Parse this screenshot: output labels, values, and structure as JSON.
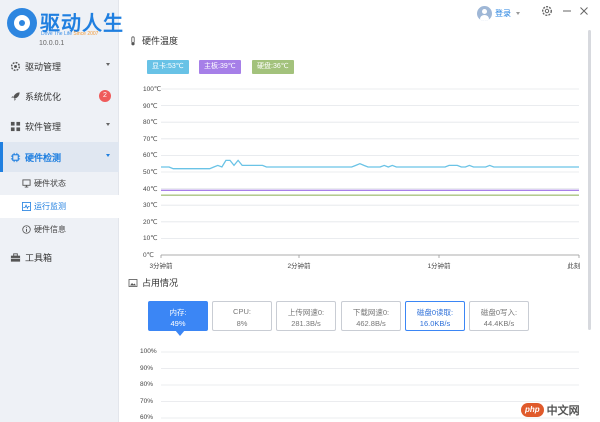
{
  "app": {
    "name": "驱动人生",
    "tagline_prefix": "Drive The Life ",
    "tagline_since": "Since 2007",
    "version": "10.0.0.1"
  },
  "topbar": {
    "login_label": "登录",
    "settings_icon": "gear-icon",
    "minimize_icon": "minimize-icon",
    "close_icon": "close-icon"
  },
  "sidebar": {
    "items": [
      {
        "label": "驱动管理",
        "icon": "gear-icon"
      },
      {
        "label": "系统优化",
        "icon": "rocket-icon",
        "badge": "2"
      },
      {
        "label": "软件管理",
        "icon": "grid-icon"
      },
      {
        "label": "硬件检测",
        "icon": "chip-icon",
        "active": true
      },
      {
        "label": "工具箱",
        "icon": "toolbox-icon"
      }
    ],
    "sub_items": [
      {
        "label": "硬件状态",
        "icon": "monitor-icon"
      },
      {
        "label": "运行监测",
        "icon": "pulse-icon",
        "active": true
      },
      {
        "label": "硬件信息",
        "icon": "info-icon"
      }
    ]
  },
  "temperature": {
    "title": "硬件温度",
    "tags": [
      {
        "label": "显卡:53℃",
        "color": "#68c2e6"
      },
      {
        "label": "主板:39℃",
        "color": "#a67fe8"
      },
      {
        "label": "硬盘:36℃",
        "color": "#a3c27c"
      }
    ]
  },
  "usage": {
    "title": "占用情况",
    "cards": [
      {
        "line1": "内存:",
        "line2": "49%",
        "state": "selected"
      },
      {
        "line1": "CPU:",
        "line2": "8%",
        "state": "normal"
      },
      {
        "line1": "上传网速0:",
        "line2": "281.3B/s",
        "state": "normal"
      },
      {
        "line1": "下载网速0:",
        "line2": "462.8B/s",
        "state": "normal"
      },
      {
        "line1": "磁盘0读取:",
        "line2": "16.0KB/s",
        "state": "outlined"
      },
      {
        "line1": "磁盘0写入:",
        "line2": "44.4KB/s",
        "state": "normal"
      }
    ]
  },
  "chart_data": [
    {
      "type": "line",
      "y_tick_labels": [
        "100℃",
        "90℃",
        "80℃",
        "70℃",
        "60℃",
        "50℃",
        "40℃",
        "30℃",
        "20℃",
        "10℃",
        "0℃"
      ],
      "x_tick_labels": [
        "3分钟前",
        "2分钟前",
        "1分钟前",
        "此刻"
      ],
      "ylim": [
        0,
        100
      ],
      "grid": true,
      "series": [
        {
          "name": "显卡",
          "color": "#6ac3e6",
          "values": [
            53,
            53,
            53,
            52,
            52,
            52,
            52,
            52,
            52,
            52,
            52,
            52,
            52,
            53,
            54,
            53,
            57,
            57,
            54,
            57,
            54,
            54,
            54,
            54,
            54,
            54,
            53,
            53,
            53,
            53,
            53,
            53,
            53,
            53,
            53,
            53,
            53,
            53,
            53,
            53,
            53,
            53,
            53,
            53,
            53,
            53,
            53,
            53,
            54,
            55,
            54,
            53,
            53,
            53,
            53,
            54,
            53,
            54,
            53,
            53,
            53,
            53,
            53,
            53,
            53,
            53,
            53,
            53,
            53,
            53,
            53,
            54,
            54,
            54,
            53,
            53,
            54,
            53,
            53,
            53,
            53,
            54,
            53,
            53,
            53,
            53,
            53,
            53,
            53,
            53,
            53,
            53,
            53,
            53,
            53,
            53,
            53,
            53,
            53,
            53,
            53,
            53,
            53,
            53
          ]
        },
        {
          "name": "主板",
          "color": "#a880e8",
          "values": [
            39,
            39,
            39,
            39,
            39,
            39,
            39,
            39,
            39,
            39,
            39,
            39,
            39,
            39,
            39,
            39,
            39,
            39,
            39,
            39,
            39,
            39,
            39,
            39,
            39,
            39,
            39,
            39,
            39,
            39,
            39,
            39,
            39,
            39,
            39,
            39,
            39,
            39,
            39,
            39,
            39,
            39,
            39,
            39,
            39,
            39,
            39,
            39,
            39,
            39,
            39,
            39,
            39,
            39,
            39,
            39,
            39,
            39,
            39,
            39,
            39,
            39,
            39,
            39,
            39,
            39,
            39,
            39,
            39,
            39,
            39,
            39,
            39,
            39,
            39,
            39,
            39,
            39,
            39,
            39,
            39,
            39,
            39,
            39,
            39,
            39,
            39,
            39,
            39,
            39,
            39,
            39,
            39,
            39,
            39,
            39,
            39,
            39,
            39,
            39,
            39,
            39,
            39,
            39
          ]
        },
        {
          "name": "硬盘",
          "color": "#a8c37f",
          "values": [
            36,
            36,
            36,
            36,
            36,
            36,
            36,
            36,
            36,
            36,
            36,
            36,
            36,
            36,
            36,
            36,
            36,
            36,
            36,
            36,
            36,
            36,
            36,
            36,
            36,
            36,
            36,
            36,
            36,
            36,
            36,
            36,
            36,
            36,
            36,
            36,
            36,
            36,
            36,
            36,
            36,
            36,
            36,
            36,
            36,
            36,
            36,
            36,
            36,
            36,
            36,
            36,
            36,
            36,
            36,
            36,
            36,
            36,
            36,
            36,
            36,
            36,
            36,
            36,
            36,
            36,
            36,
            36,
            36,
            36,
            36,
            36,
            36,
            36,
            36,
            36,
            36,
            36,
            36,
            36,
            36,
            36,
            36,
            36,
            36,
            36,
            36,
            36,
            36,
            36,
            36,
            36,
            36,
            36,
            36,
            36,
            36,
            36,
            36,
            36,
            36,
            36,
            36,
            36
          ]
        }
      ]
    },
    {
      "type": "line",
      "y_tick_labels": [
        "100%",
        "90%",
        "80%",
        "70%",
        "60%"
      ],
      "ylim": [
        60,
        100
      ],
      "grid": true,
      "series": []
    }
  ],
  "watermark": {
    "logo": "php",
    "text": "中文网"
  }
}
